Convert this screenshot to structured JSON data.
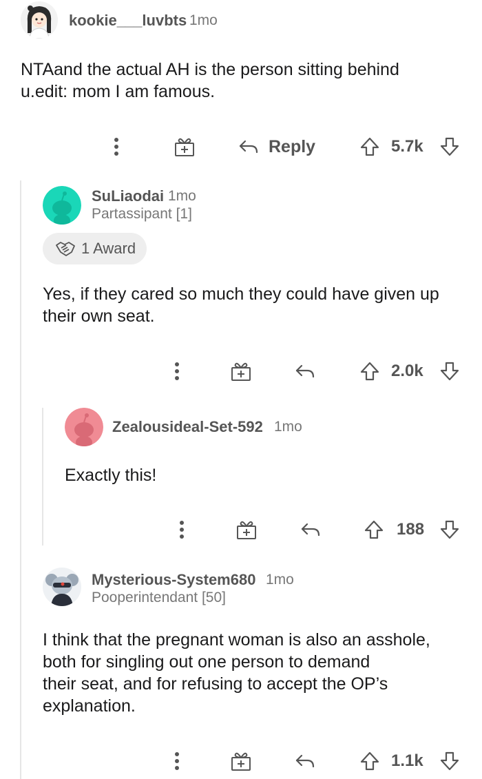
{
  "comments": [
    {
      "author": "kookie___luvbts",
      "age": "1mo",
      "body_lines": [
        "NTAand the actual AH is the person sitting behind",
        "u.edit: mom I am famous."
      ],
      "reply_label": "Reply",
      "score": "5.7k",
      "avatar_icon": "girl-avatar-icon"
    },
    {
      "author": "SuLiaodai",
      "age": "1mo",
      "flair": "Partassipant [1]",
      "award_label": "1 Award",
      "body_lines": [
        "Yes, if they cared so much they could have given up",
        "their own seat."
      ],
      "score": "2.0k",
      "avatar_color": "#1ad7b8"
    },
    {
      "author": "Zealousideal-Set-592",
      "age": "1mo",
      "body_lines": [
        "Exactly this!"
      ],
      "score": "188",
      "avatar_color": "#f08b94"
    },
    {
      "author": "Mysterious-System680",
      "age": "1mo",
      "flair": "Pooperintendant [50]",
      "body_lines": [
        "I think that the pregnant woman is also an asshole,",
        "both for singling out one person to demand",
        "their seat, and for refusing to accept the OP’s",
        "explanation."
      ],
      "score": "1.1k",
      "avatar_icon": "koala-avatar-icon"
    }
  ]
}
